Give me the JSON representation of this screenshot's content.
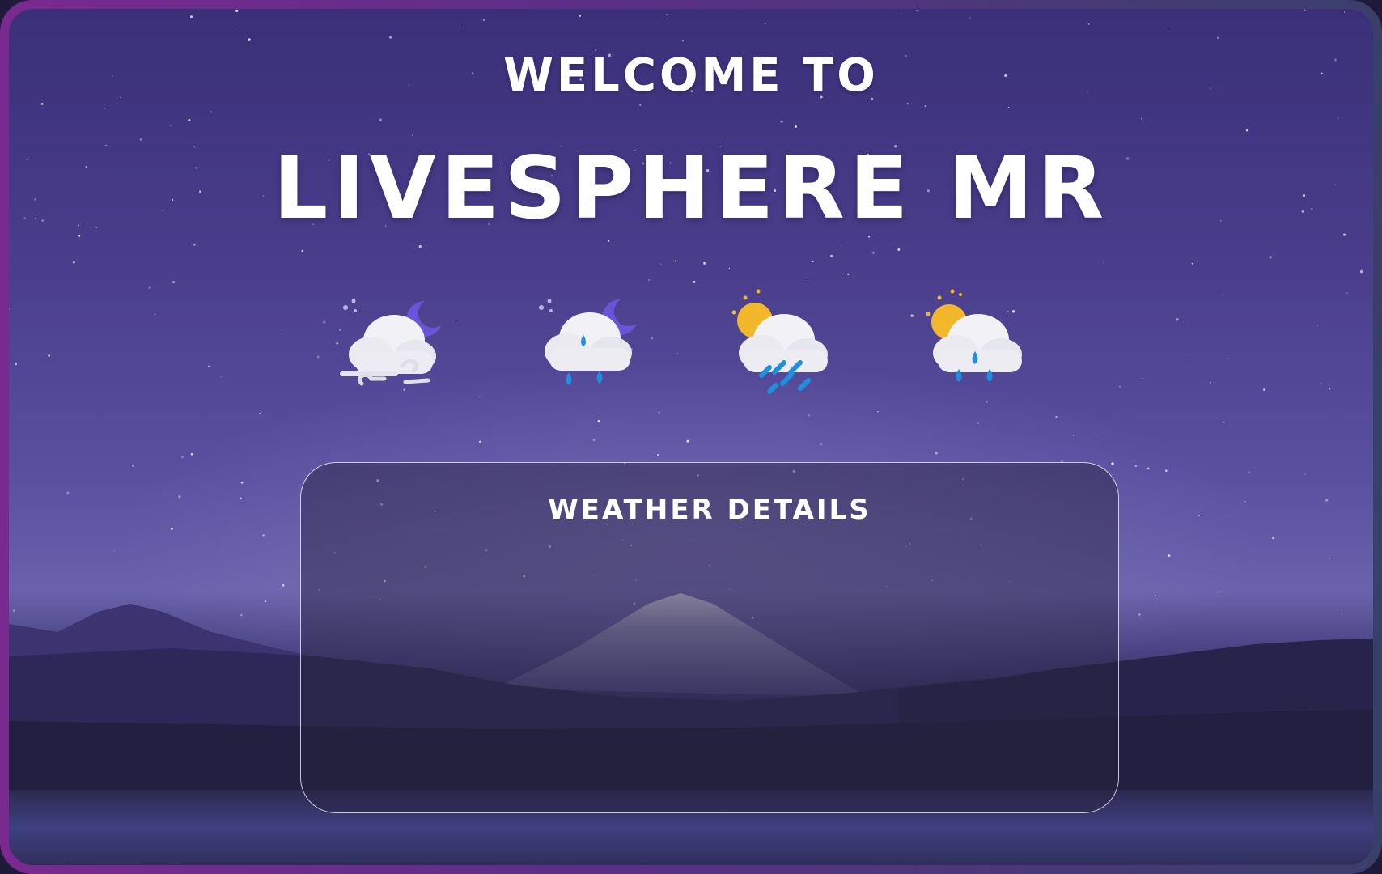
{
  "hero": {
    "welcome": "WELCOME TO",
    "brand": "LIVESPHERE MR"
  },
  "forecast_icons": [
    {
      "icon": "windy-night-cloud-icon"
    },
    {
      "icon": "rainy-night-cloud-icon"
    },
    {
      "icon": "sunny-thunder-rain-cloud-icon"
    },
    {
      "icon": "sunny-rain-cloud-icon"
    }
  ],
  "details_panel": {
    "title": "WEATHER DETAILS"
  },
  "colors": {
    "frame_gradient_start": "#7a2a8f",
    "frame_gradient_end": "#3a3f6a",
    "sky": "#4a3e8c",
    "moon": "#6b54d8",
    "sun": "#f2b72a",
    "rain": "#1f8fe0"
  }
}
